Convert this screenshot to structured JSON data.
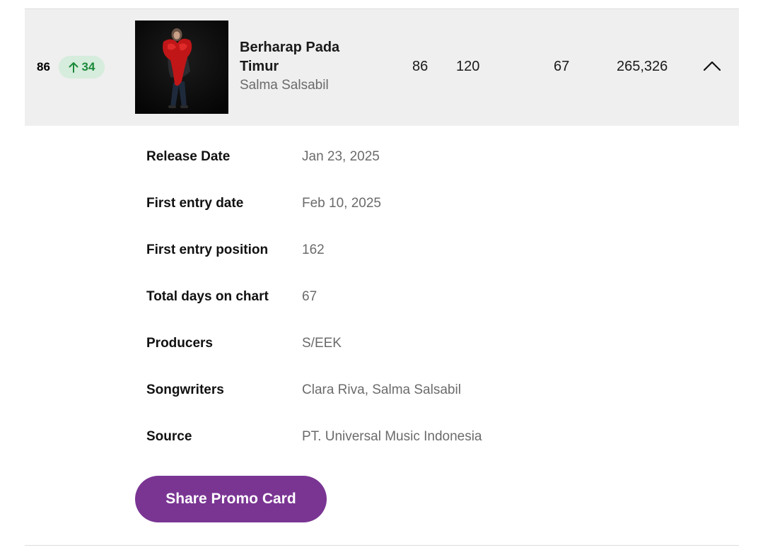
{
  "track": {
    "rank": "86",
    "movement": {
      "direction": "up",
      "value": "34",
      "color": "#1c8a3a",
      "icon": "arrow-up-icon"
    },
    "cover_icon": "album-cover-image",
    "title": "Berharap Pada Timur",
    "artist": "Salma Salsabil",
    "stats": {
      "previous_rank": "86",
      "peak": "120",
      "days_on_chart": "67",
      "streams": "265,326"
    },
    "toggle_icon": "chevron-up-icon"
  },
  "details": [
    {
      "label": "Release Date",
      "value": "Jan 23, 2025"
    },
    {
      "label": "First entry date",
      "value": "Feb 10, 2025"
    },
    {
      "label": "First entry position",
      "value": "162"
    },
    {
      "label": "Total days on chart",
      "value": "67"
    },
    {
      "label": "Producers",
      "value": "S/EEK"
    },
    {
      "label": "Songwriters",
      "value": "Clara Riva, Salma Salsabil"
    },
    {
      "label": "Source",
      "value": "PT. Universal Music Indonesia"
    }
  ],
  "share_button": {
    "label": "Share Promo Card",
    "color": "#7a3593"
  },
  "colors": {
    "row_background": "#efefef",
    "badge_background": "#d6ecdc",
    "muted_text": "#6b6b6b"
  }
}
